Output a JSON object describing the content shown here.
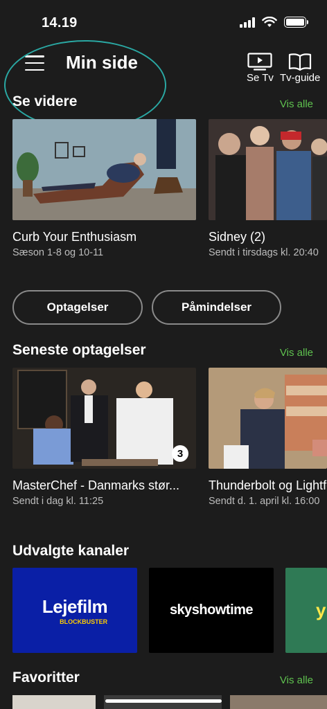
{
  "status": {
    "time": "14.19"
  },
  "header": {
    "title": "Min side",
    "actions": [
      {
        "label": "Se Tv",
        "icon": "tv-play-icon"
      },
      {
        "label": "Tv-guide",
        "icon": "book-icon"
      }
    ]
  },
  "continue_watching": {
    "title": "Se videre",
    "see_all": "Vis alle",
    "items": [
      {
        "title": "Curb Your Enthusiasm",
        "subtitle": "Sæson 1-8 og 10-11"
      },
      {
        "title": "Sidney (2)",
        "subtitle": "Sendt i tirsdags kl. 20:40"
      }
    ]
  },
  "buttons": {
    "recordings": "Optagelser",
    "reminders": "Påmindelser"
  },
  "recent_recordings": {
    "title": "Seneste optagelser",
    "see_all": "Vis alle",
    "items": [
      {
        "title": "MasterChef - Danmarks stør...",
        "subtitle": "Sendt i dag kl. 11:25",
        "channel_badge": "3"
      },
      {
        "title": "Thunderbolt og Lightfoot",
        "subtitle": "Sendt d. 1. april kl. 16:00"
      }
    ]
  },
  "channels": {
    "title": "Udvalgte kanaler",
    "items": [
      {
        "name": "Lejefilm",
        "sub": "BLOCKBUSTER",
        "color": "#0a1fa6"
      },
      {
        "name": "skyshowtime",
        "color": "#000000"
      },
      {
        "name": "y",
        "color": "#2f7a55"
      }
    ]
  },
  "favorites": {
    "title": "Favoritter",
    "see_all": "Vis alle"
  },
  "colors": {
    "accent_green": "#5fc24f",
    "background": "#1c1c1c",
    "highlight": "#2aa8a3"
  }
}
